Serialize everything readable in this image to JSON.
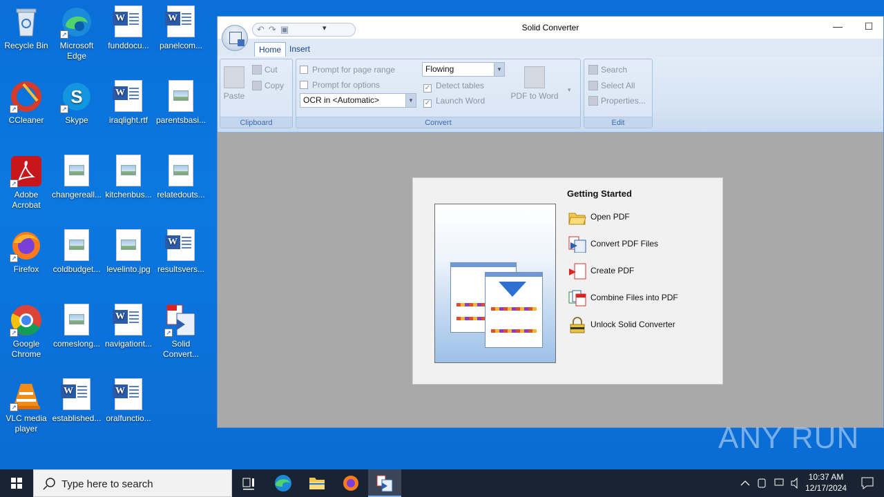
{
  "desktop": {
    "icons": [
      {
        "label": "Recycle Bin",
        "icon": "recycle-bin-icon"
      },
      {
        "label": "Microsoft Edge",
        "icon": "edge-icon"
      },
      {
        "label": "funddocu...",
        "icon": "word-doc-icon"
      },
      {
        "label": "panelcom...",
        "icon": "word-doc-icon"
      },
      {
        "label": "CCleaner",
        "icon": "ccleaner-icon"
      },
      {
        "label": "Skype",
        "icon": "skype-icon"
      },
      {
        "label": "iraqlight.rtf",
        "icon": "word-doc-icon"
      },
      {
        "label": "parentsbasi...",
        "icon": "image-file-icon"
      },
      {
        "label": "Adobe Acrobat",
        "icon": "acrobat-icon"
      },
      {
        "label": "changereall...",
        "icon": "image-file-icon"
      },
      {
        "label": "kitchenbus...",
        "icon": "image-file-icon"
      },
      {
        "label": "relatedouts...",
        "icon": "image-file-icon"
      },
      {
        "label": "Firefox",
        "icon": "firefox-icon"
      },
      {
        "label": "coldbudget...",
        "icon": "image-file-icon"
      },
      {
        "label": "levelinto.jpg",
        "icon": "image-file-icon"
      },
      {
        "label": "resultsvers...",
        "icon": "word-doc-icon"
      },
      {
        "label": "Google Chrome",
        "icon": "chrome-icon"
      },
      {
        "label": "comeslong...",
        "icon": "image-file-icon"
      },
      {
        "label": "navigationt...",
        "icon": "word-doc-icon"
      },
      {
        "label": "Solid Convert...",
        "icon": "solid-converter-icon"
      },
      {
        "label": "VLC media player",
        "icon": "vlc-icon"
      },
      {
        "label": "established...",
        "icon": "word-doc-icon"
      },
      {
        "label": "oralfunctio...",
        "icon": "word-doc-icon"
      }
    ]
  },
  "window": {
    "title": "Solid Converter",
    "minimize": "—",
    "maximize": "☐",
    "tabs": [
      "Home",
      "Insert"
    ],
    "clipboard": {
      "label": "Clipboard",
      "paste": "Paste",
      "cut": "Cut",
      "copy": "Copy"
    },
    "convert": {
      "label": "Convert",
      "prompt_page_range": "Prompt for page range",
      "prompt_options": "Prompt for options",
      "ocr_value": "OCR in <Automatic>",
      "layout_value": "Flowing",
      "detect_tables": "Detect tables",
      "launch_word": "Launch Word",
      "pdf_to_word": "PDF to Word"
    },
    "edit": {
      "label": "Edit",
      "search": "Search",
      "select_all": "Select All",
      "properties": "Properties..."
    },
    "getting_started": {
      "heading": "Getting Started",
      "items": [
        "Open PDF",
        "Convert PDF Files",
        "Create PDF",
        "Combine Files into PDF",
        "Unlock Solid Converter"
      ]
    }
  },
  "taskbar": {
    "search_placeholder": "Type here to search",
    "time": "10:37 AM",
    "date": "12/17/2024"
  },
  "watermark": "ANY RUN"
}
